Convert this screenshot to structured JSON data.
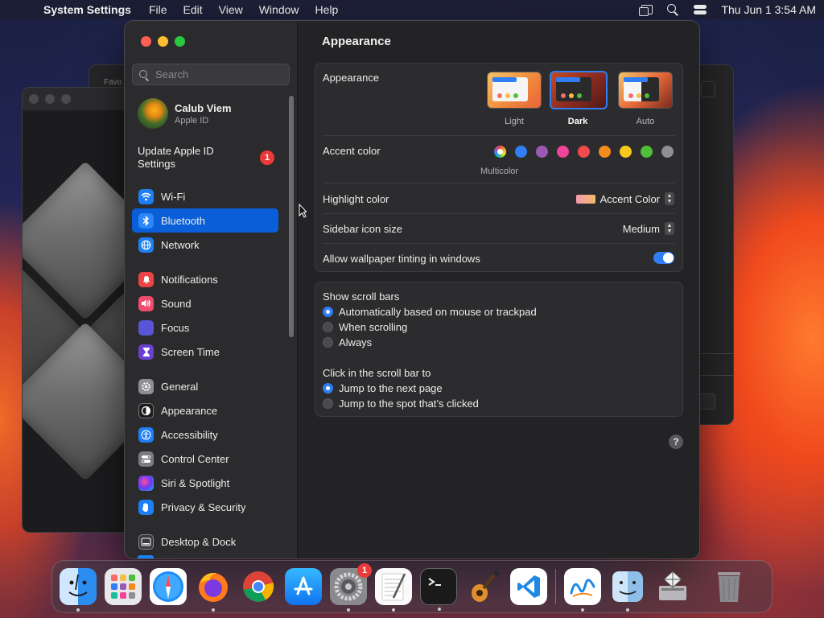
{
  "menubar": {
    "app_name": "System Settings",
    "menus": [
      "File",
      "Edit",
      "View",
      "Window",
      "Help"
    ],
    "clock": "Thu Jun 1  3:54 AM"
  },
  "background_window": {
    "label": "Favo"
  },
  "sidebar": {
    "search_placeholder": "Search",
    "profile": {
      "name": "Calub Viem",
      "subtitle": "Apple ID"
    },
    "update": {
      "label": "Update Apple ID Settings",
      "badge": "1"
    },
    "items": [
      {
        "label": "Wi-Fi",
        "icon": "wifi-icon"
      },
      {
        "label": "Bluetooth",
        "icon": "bluetooth-icon",
        "selected": true
      },
      {
        "label": "Network",
        "icon": "globe-icon"
      },
      {
        "label": "Notifications",
        "icon": "bell-icon"
      },
      {
        "label": "Sound",
        "icon": "speaker-icon"
      },
      {
        "label": "Focus",
        "icon": "moon-icon"
      },
      {
        "label": "Screen Time",
        "icon": "hourglass-icon"
      },
      {
        "label": "General",
        "icon": "gear-icon"
      },
      {
        "label": "Appearance",
        "icon": "appearance-icon"
      },
      {
        "label": "Accessibility",
        "icon": "accessibility-icon"
      },
      {
        "label": "Control Center",
        "icon": "control-center-icon"
      },
      {
        "label": "Siri & Spotlight",
        "icon": "siri-icon"
      },
      {
        "label": "Privacy & Security",
        "icon": "hand-icon"
      },
      {
        "label": "Desktop & Dock",
        "icon": "dock-icon"
      }
    ]
  },
  "content": {
    "title": "Appearance",
    "appearance": {
      "label": "Appearance",
      "options": [
        "Light",
        "Dark",
        "Auto"
      ],
      "selected": "Dark"
    },
    "accent": {
      "label": "Accent color",
      "colors": [
        "#2f7ef4",
        "#9b59b6",
        "#f0449a",
        "#f14b4b",
        "#f58a1f",
        "#f8c81c",
        "#4fbf3a",
        "#8e8e93"
      ],
      "selected_label": "Multicolor"
    },
    "highlight": {
      "label": "Highlight color",
      "value": "Accent Color"
    },
    "sidebar_icon_size": {
      "label": "Sidebar icon size",
      "value": "Medium"
    },
    "wallpaper_tinting": {
      "label": "Allow wallpaper tinting in windows",
      "enabled": true
    },
    "scroll_bars": {
      "label": "Show scroll bars",
      "options": [
        "Automatically based on mouse or trackpad",
        "When scrolling",
        "Always"
      ],
      "selected": 0
    },
    "click_scroll": {
      "label": "Click in the scroll bar to",
      "options": [
        "Jump to the next page",
        "Jump to the spot that’s clicked"
      ],
      "selected": 0
    },
    "help": "?"
  },
  "dock": {
    "apps": [
      "Finder",
      "Launchpad",
      "Safari",
      "Firefox",
      "Chrome",
      "App Store",
      "System Settings",
      "TextEdit",
      "Terminal",
      "GarageBand",
      "Visual Studio Code",
      "Freeform",
      "Migration Assistant",
      "Boot Camp Assistant",
      "Trash"
    ],
    "system_settings_badge": "1"
  }
}
